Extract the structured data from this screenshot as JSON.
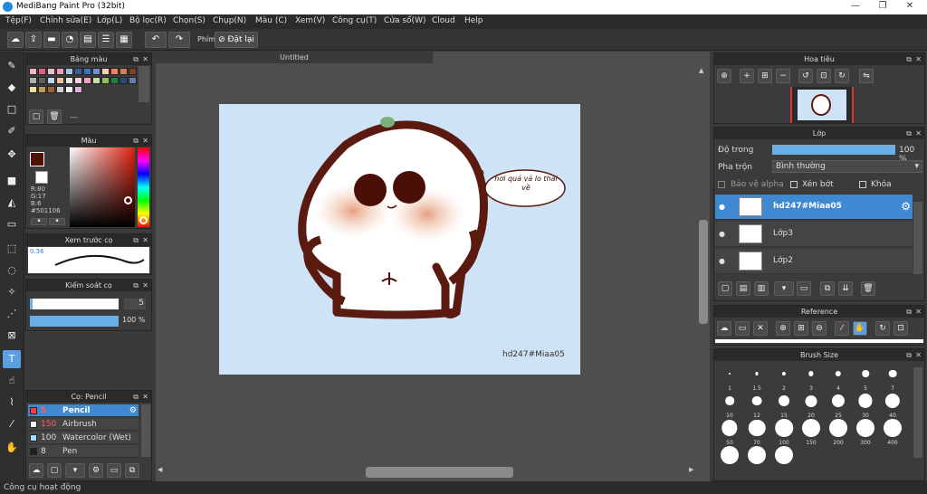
{
  "window": {
    "title": "MediBang Paint Pro (32bit)",
    "min": "—",
    "max": "❐",
    "close": "✕"
  },
  "menu": [
    "Tệp(F)",
    "Chỉnh sửa(E)",
    "Lớp(L)",
    "Bộ lọc(R)",
    "Chọn(S)",
    "Chụp(N)",
    "Màu (C)",
    "Xem(V)",
    "Công cụ(T)",
    "Cửa sổ(W)",
    "Cloud",
    "Help"
  ],
  "toolbar": {
    "key_label": "Phím",
    "reset_label": "Đặt lại"
  },
  "palette_panel": {
    "title": "Bảng màu",
    "range": "---",
    "colors": [
      "#f3b6c6",
      "#e06080",
      "#ecc0d4",
      "#e8a0b0",
      "#a0c4e8",
      "#3a5e9a",
      "#4070c0",
      "#7090c8",
      "#f4d0b0",
      "#f08060",
      "#cc8060",
      "#804020",
      "#b0b0b0",
      "#606060",
      "#c0d8f0",
      "#f0c0a0",
      "#e8e8e8",
      "#f8d0d8",
      "#f0a0c0",
      "#c8e0a0",
      "#90c060",
      "#208040",
      "#304870",
      "#6080a8",
      "#f0e0a0",
      "#c0a050",
      "#a06030",
      "#d0d0d0",
      "#f0f0f0",
      "#e0b0e0"
    ]
  },
  "color_panel": {
    "title": "Màu",
    "r": "R:80",
    "g": "G:17",
    "b": "B:6",
    "hex": "#501106",
    "fg": "#501106"
  },
  "preview_panel": {
    "title": "Xem trước cọ",
    "value": "0.36"
  },
  "brush_control": {
    "title": "Kiểm soát cọ",
    "size": "5",
    "opacity": "100 %",
    "opacity_pct": 100,
    "size_pct": 3
  },
  "brush_panel": {
    "title": "Cọ: Pencil",
    "items": [
      {
        "size": "5",
        "name": "Pencil",
        "color": "#ff4040"
      },
      {
        "size": "150",
        "name": "Airbrush",
        "color": "#ffffff"
      },
      {
        "size": "100",
        "name": "Watercolor (Wet)",
        "color": "#a0e0ff"
      },
      {
        "size": "8",
        "name": "Pen",
        "color": "#202020"
      }
    ]
  },
  "document": {
    "tab": "Untitled",
    "signature": "hd247#Miaa05",
    "bubble_text": "hơi quả vả lo thai về"
  },
  "navigator": {
    "title": "Hoa tiêu"
  },
  "layer_panel": {
    "title": "Lớp",
    "opacity_label": "Độ trong",
    "opacity_value": "100 %",
    "opacity_pct": 100,
    "blend_label": "Pha trộn",
    "blend_value": "Bình thường",
    "protect_alpha": "Bảo vệ alpha",
    "clipping": "Xén bớt",
    "lock": "Khóa",
    "layers": [
      {
        "name": "hd247#Miaa05",
        "selected": true
      },
      {
        "name": "Lớp3",
        "selected": false
      },
      {
        "name": "Lớp2",
        "selected": false
      }
    ]
  },
  "reference_panel": {
    "title": "Reference"
  },
  "brush_size_panel": {
    "title": "Brush Size",
    "sizes": [
      "1",
      "1.5",
      "2",
      "3",
      "4",
      "5",
      "7",
      "10",
      "12",
      "15",
      "20",
      "25",
      "30",
      "40",
      "50",
      "70",
      "100",
      "150",
      "200",
      "300",
      "400"
    ]
  },
  "status": {
    "text": "Công cụ hoạt động"
  }
}
